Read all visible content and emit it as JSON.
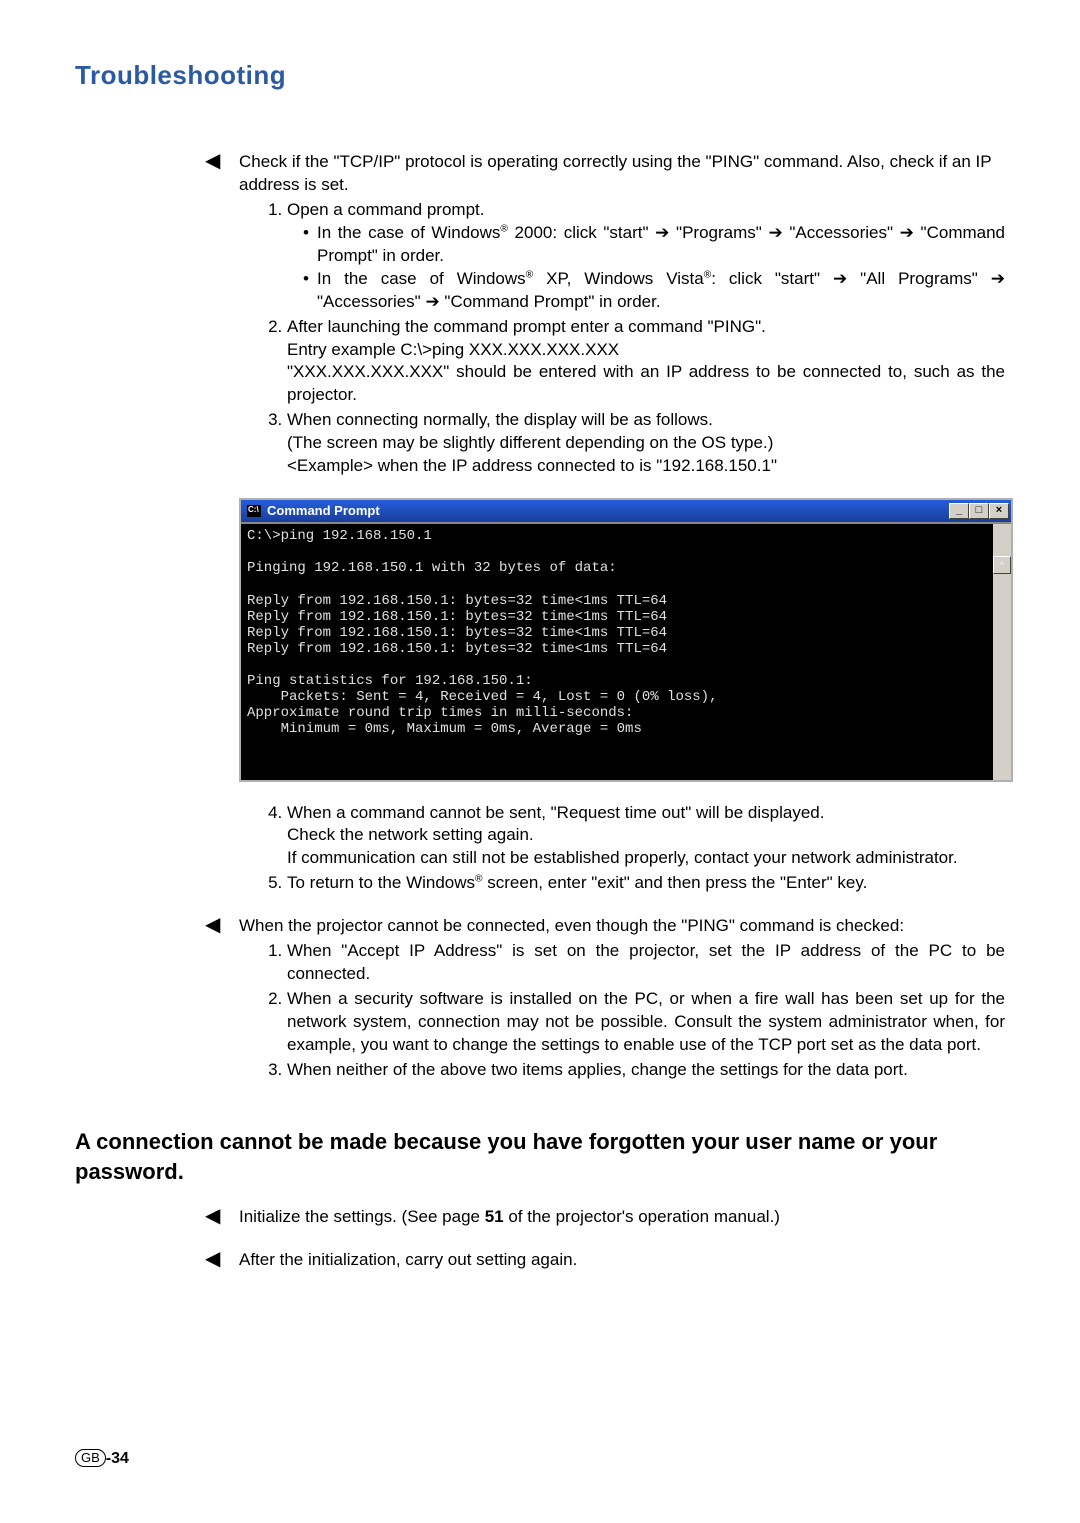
{
  "title": "Troubleshooting",
  "section1": {
    "intro": "Check if the \"TCP/IP\" protocol is operating correctly using the \"PING\" command. Also, check if an IP address is set.",
    "step1": "Open a command prompt.",
    "step1b1a": "In the case of Windows",
    "step1b1b": " 2000: click \"start\" ",
    "step1b1c": " \"Programs\" ",
    "step1b1d": " \"Accessories\" ",
    "step1b1e": " \"Command Prompt\" in order.",
    "step1b2a": "In the case of Windows",
    "step1b2b": " XP, Windows Vista",
    "step1b2c": ": click \"start\" ",
    "step1b2d": " \"All Programs\" ",
    "step1b2e": " \"Accessories\" ",
    "step1b2f": " \"Command Prompt\" in order.",
    "step2a": "After launching the command prompt enter a command \"PING\".",
    "step2b": "Entry example C:\\>ping XXX.XXX.XXX.XXX",
    "step2c": "\"XXX.XXX.XXX.XXX\" should be entered with an IP address to be connected to, such as the projector.",
    "step3a": "When connecting normally, the display will be as follows.",
    "step3b": "(The screen may be slightly different depending on the OS type.)",
    "step3c": "<Example> when the IP address connected to is \"192.168.150.1\"",
    "step4a": "When a command cannot be sent, \"Request time out\" will be displayed.",
    "step4b": "Check the network setting again.",
    "step4c": "If communication can still not be established properly, contact your network administrator.",
    "step5a": "To return to the Windows",
    "step5b": " screen, enter \"exit\" and then press the \"Enter\" key."
  },
  "cmd": {
    "title": "Command Prompt",
    "body": "C:\\>ping 192.168.150.1\n\nPinging 192.168.150.1 with 32 bytes of data:\n\nReply from 192.168.150.1: bytes=32 time<1ms TTL=64\nReply from 192.168.150.1: bytes=32 time<1ms TTL=64\nReply from 192.168.150.1: bytes=32 time<1ms TTL=64\nReply from 192.168.150.1: bytes=32 time<1ms TTL=64\n\nPing statistics for 192.168.150.1:\n    Packets: Sent = 4, Received = 4, Lost = 0 (0% loss),\nApproximate round trip times in milli-seconds:\n    Minimum = 0ms, Maximum = 0ms, Average = 0ms"
  },
  "section2": {
    "intro": "When the projector cannot be connected, even though the \"PING\" command is checked:",
    "step1": "When \"Accept IP Address\" is set on the projector, set the IP address of the PC to be connected.",
    "step2": "When a security software is installed on the PC, or when a fire wall has been set up for the network system, connection may not be possible. Consult the system administrator when, for example, you want to change the settings to enable use of the TCP port set as the data port.",
    "step3": "When neither of the above two items applies, change the settings for the data port."
  },
  "heading2": "A connection cannot be made because you have forgotten your user name or your password.",
  "section3": {
    "b1a": "Initialize the settings. (See page ",
    "b1page": "51",
    "b1b": " of the projector's operation manual.)",
    "b2": "After the initialization, carry out setting again."
  },
  "footer": {
    "gb": "GB",
    "page": "-34"
  },
  "arrow": "➔",
  "larrow": "◀",
  "reg": "®",
  "scrollglyph": "▴",
  "min": "_",
  "max": "□",
  "close": "×"
}
